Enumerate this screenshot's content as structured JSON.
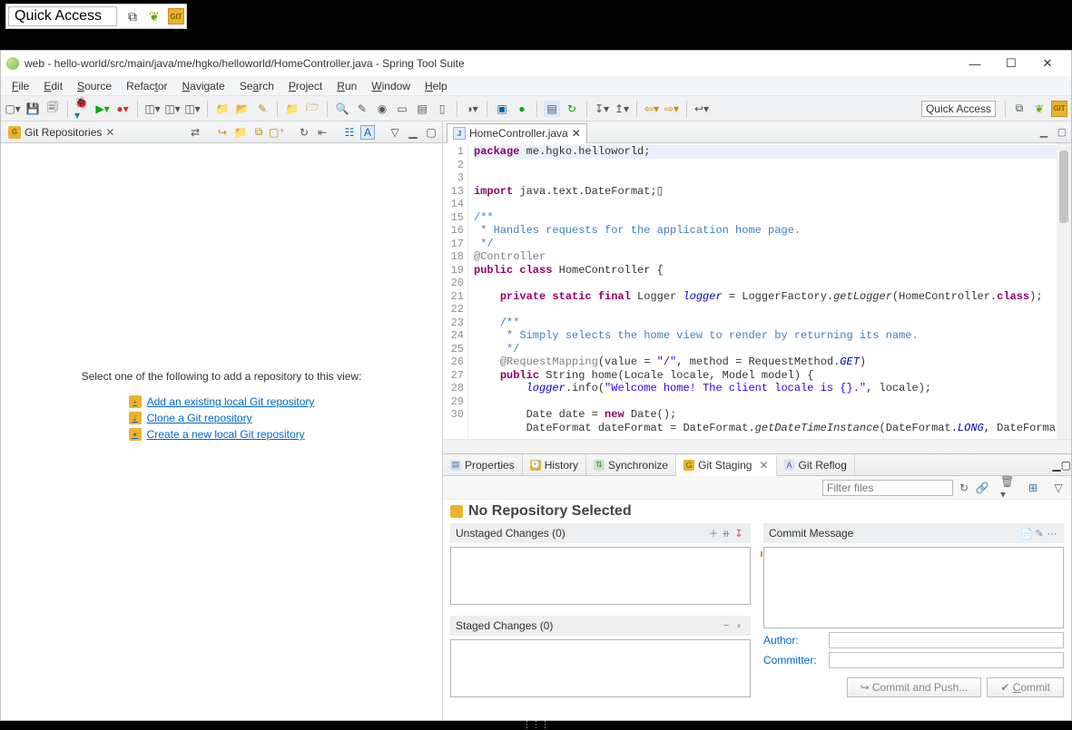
{
  "topStrip": {
    "quickAccess": "Quick Access"
  },
  "window": {
    "title": "web - hello-world/src/main/java/me/hgko/helloworld/HomeController.java - Spring Tool Suite",
    "minimize": "—",
    "maximize": "☐",
    "close": "✕"
  },
  "menu": [
    "File",
    "Edit",
    "Source",
    "Refactor",
    "Navigate",
    "Search",
    "Project",
    "Run",
    "Window",
    "Help"
  ],
  "quickAccessRight": "Quick Access",
  "gitReposView": {
    "title": "Git Repositories",
    "prompt": "Select one of the following to add a repository to this view:",
    "links": {
      "add": "Add an existing local Git repository",
      "clone": "Clone a Git repository",
      "create": "Create a new local Git repository"
    }
  },
  "editor": {
    "tabTitle": "HomeController.java",
    "lines": [
      "1",
      "2",
      "3",
      "13",
      "14",
      "15",
      "16",
      "17",
      "18",
      "19",
      "20",
      "21",
      "22",
      "23",
      "24",
      "25",
      "26",
      "27",
      "28",
      "29",
      "30"
    ]
  },
  "bottom": {
    "tabs": {
      "properties": "Properties",
      "history": "History",
      "synchronize": "Synchronize",
      "gitStaging": "Git Staging",
      "gitReflog": "Git Reflog"
    },
    "filterPlaceholder": "Filter files",
    "noRepo": "No Repository Selected",
    "unstaged": "Unstaged Changes (0)",
    "staged": "Staged Changes (0)",
    "commitMsg": "Commit Message",
    "author": "Author:",
    "committer": "Committer:",
    "commitPush": "Commit and Push...",
    "commit": "Commit"
  }
}
